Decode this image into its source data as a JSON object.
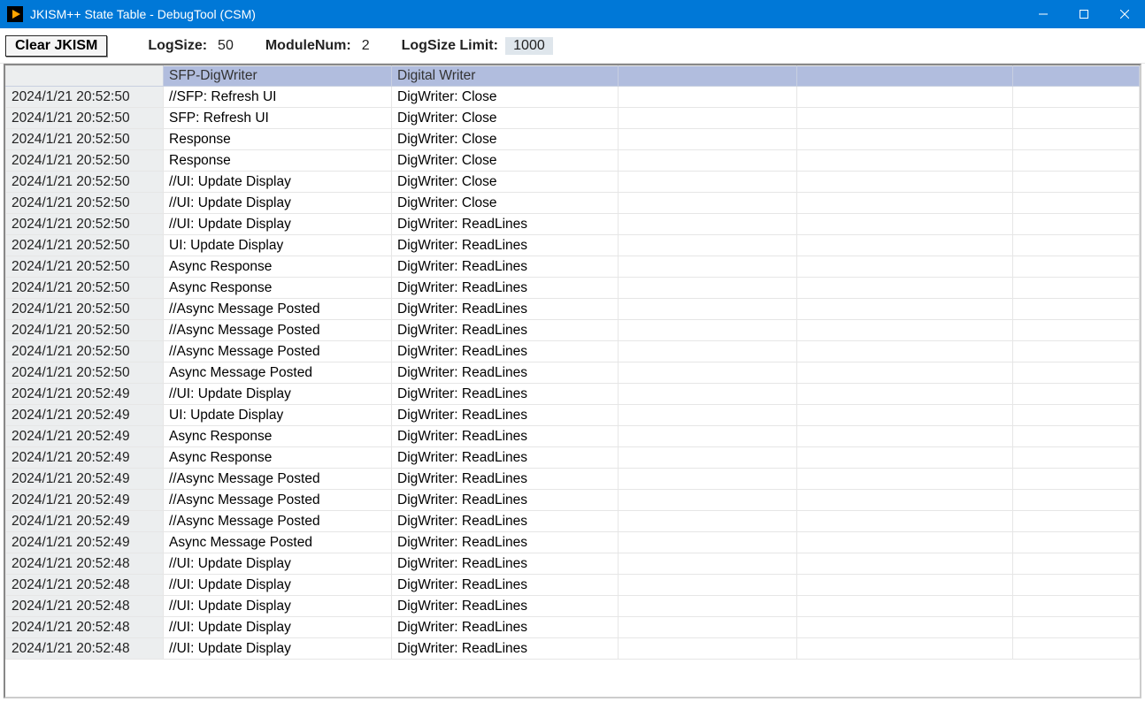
{
  "window": {
    "title": "JKISM++ State Table - DebugTool (CSM)"
  },
  "toolbar": {
    "clear_button": "Clear JKISM",
    "logsize_label": "LogSize:",
    "logsize_value": "50",
    "modulenum_label": "ModuleNum:",
    "modulenum_value": "2",
    "logsize_limit_label": "LogSize Limit:",
    "logsize_limit_value": "1000"
  },
  "table": {
    "headers": [
      "",
      "SFP-DigWriter",
      "Digital Writer",
      "",
      "",
      ""
    ],
    "rows": [
      {
        "t": "2024/1/21 20:52:50",
        "c1": "//SFP: Refresh UI",
        "c2": "DigWriter: Close"
      },
      {
        "t": "2024/1/21 20:52:50",
        "c1": "SFP: Refresh UI",
        "c2": "DigWriter: Close"
      },
      {
        "t": "2024/1/21 20:52:50",
        "c1": "Response",
        "c2": "DigWriter: Close"
      },
      {
        "t": "2024/1/21 20:52:50",
        "c1": "Response",
        "c2": "DigWriter: Close"
      },
      {
        "t": "2024/1/21 20:52:50",
        "c1": "//UI: Update Display",
        "c2": "DigWriter: Close"
      },
      {
        "t": "2024/1/21 20:52:50",
        "c1": "//UI: Update Display",
        "c2": "DigWriter: Close"
      },
      {
        "t": "2024/1/21 20:52:50",
        "c1": "//UI: Update Display",
        "c2": "DigWriter: ReadLines"
      },
      {
        "t": "2024/1/21 20:52:50",
        "c1": "UI: Update Display",
        "c2": "DigWriter: ReadLines"
      },
      {
        "t": "2024/1/21 20:52:50",
        "c1": "Async Response",
        "c2": "DigWriter: ReadLines"
      },
      {
        "t": "2024/1/21 20:52:50",
        "c1": "Async Response",
        "c2": "DigWriter: ReadLines"
      },
      {
        "t": "2024/1/21 20:52:50",
        "c1": "//Async Message Posted",
        "c2": "DigWriter: ReadLines"
      },
      {
        "t": "2024/1/21 20:52:50",
        "c1": "//Async Message Posted",
        "c2": "DigWriter: ReadLines"
      },
      {
        "t": "2024/1/21 20:52:50",
        "c1": "//Async Message Posted",
        "c2": "DigWriter: ReadLines"
      },
      {
        "t": "2024/1/21 20:52:50",
        "c1": "Async Message Posted",
        "c2": "DigWriter: ReadLines"
      },
      {
        "t": "2024/1/21 20:52:49",
        "c1": "//UI: Update Display",
        "c2": "DigWriter: ReadLines"
      },
      {
        "t": "2024/1/21 20:52:49",
        "c1": "UI: Update Display",
        "c2": "DigWriter: ReadLines"
      },
      {
        "t": "2024/1/21 20:52:49",
        "c1": "Async Response",
        "c2": "DigWriter: ReadLines"
      },
      {
        "t": "2024/1/21 20:52:49",
        "c1": "Async Response",
        "c2": "DigWriter: ReadLines"
      },
      {
        "t": "2024/1/21 20:52:49",
        "c1": "//Async Message Posted",
        "c2": "DigWriter: ReadLines"
      },
      {
        "t": "2024/1/21 20:52:49",
        "c1": "//Async Message Posted",
        "c2": "DigWriter: ReadLines"
      },
      {
        "t": "2024/1/21 20:52:49",
        "c1": "//Async Message Posted",
        "c2": "DigWriter: ReadLines"
      },
      {
        "t": "2024/1/21 20:52:49",
        "c1": "Async Message Posted",
        "c2": "DigWriter: ReadLines"
      },
      {
        "t": "2024/1/21 20:52:48",
        "c1": "//UI: Update Display",
        "c2": "DigWriter: ReadLines"
      },
      {
        "t": "2024/1/21 20:52:48",
        "c1": "//UI: Update Display",
        "c2": "DigWriter: ReadLines"
      },
      {
        "t": "2024/1/21 20:52:48",
        "c1": "//UI: Update Display",
        "c2": "DigWriter: ReadLines"
      },
      {
        "t": "2024/1/21 20:52:48",
        "c1": "//UI: Update Display",
        "c2": "DigWriter: ReadLines"
      },
      {
        "t": "2024/1/21 20:52:48",
        "c1": "//UI: Update Display",
        "c2": "DigWriter: ReadLines"
      }
    ]
  }
}
